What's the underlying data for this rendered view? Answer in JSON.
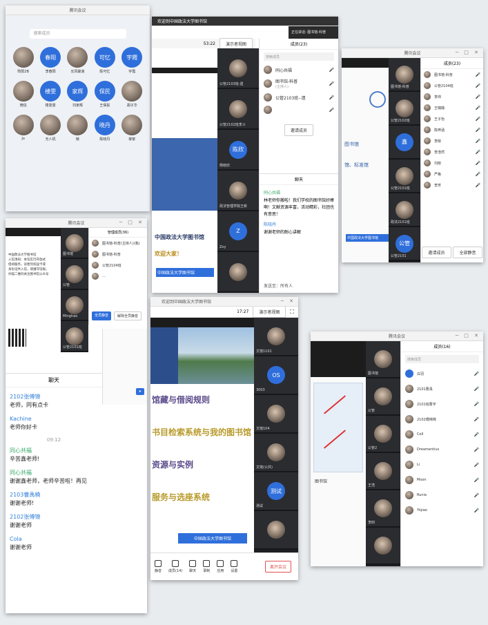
{
  "s1": {
    "title": "腾讯会议",
    "search_placeholder": "搜索成员",
    "grid": [
      {
        "text": "",
        "label": "昀阳2B",
        "photo": true
      },
      {
        "text": "春阳",
        "label": "李春阳",
        "photo": false
      },
      {
        "text": "",
        "label": "长风破浪",
        "photo": true
      },
      {
        "text": "可忆",
        "label": "陈可忆",
        "photo": false
      },
      {
        "text": "宇霞",
        "label": "宇霞",
        "photo": false
      },
      {
        "text": "",
        "label": "微信",
        "photo": true
      },
      {
        "text": "楼雯",
        "label": "楼雯雯",
        "photo": false
      },
      {
        "text": "家辉",
        "label": "刘家辉",
        "photo": false
      },
      {
        "text": "保民",
        "label": "王保民",
        "photo": false
      },
      {
        "text": "",
        "label": "胡子华",
        "photo": true
      },
      {
        "text": "",
        "label": "Jo",
        "photo": true
      },
      {
        "text": "",
        "label": "无人机",
        "photo": true
      },
      {
        "text": "",
        "label": "敏",
        "photo": true
      },
      {
        "text": "晓丹",
        "label": "陈晓丹",
        "photo": false
      },
      {
        "text": "",
        "label": "柳絮",
        "photo": true
      }
    ]
  },
  "s2": {
    "title": "欢迎到中国政法大学图书馆",
    "time": "53:22",
    "view_label": "演示者视图",
    "panel_title": "正在讲话: 图书馆-科普",
    "members_title": "成员(23)",
    "search_placeholder": "搜索成员",
    "members": [
      {
        "name": "同心共福",
        "sub": ""
      },
      {
        "name": "图书馆-科普",
        "sub": "(主持人)"
      },
      {
        "name": "公管2103班--遗",
        "sub": ""
      },
      {
        "name": "",
        "sub": ""
      }
    ],
    "invite_btn": "邀请成员",
    "chat_title": "聊天",
    "chat": [
      {
        "name": "同心共福",
        "text": "林老师你搬啦！我们学校的图书馆好棒啊！文献资源丰富，活动精彩，社团也有意思！",
        "color": "green"
      },
      {
        "name": "陈晓丹",
        "text": "谢谢老师的耐心讲解",
        "color": "blue"
      }
    ],
    "send_to": "发送至：所有人",
    "slide_lines": [
      "中国政法大学图书馆",
      "欢迎大家！"
    ],
    "slide_banner": "中国政法大学图书馆",
    "tiles": [
      {
        "name": "公管2103班-遗",
        "type": "photo",
        "text": ""
      },
      {
        "name": "公管2102班李斗",
        "type": "photo",
        "text": ""
      },
      {
        "name": "杨晓欣",
        "type": "blue",
        "text": "陈欣"
      },
      {
        "name": "政法管理学院王新",
        "type": "photo",
        "text": ""
      },
      {
        "name": "Zoy",
        "type": "blue",
        "text": "Z"
      },
      {
        "name": "",
        "type": "photo",
        "text": ""
      }
    ]
  },
  "s3": {
    "title": "腾讯会议",
    "members_title": "成员(23)",
    "members": [
      "图书馆-科普",
      "公管2104班",
      "李帅",
      "王璐璐",
      "王子怡",
      "陈梓涵",
      "李晓",
      "李浩然",
      "刘晓",
      "严格",
      "李芳"
    ],
    "invite_btn": "邀请成员",
    "more_btn": "全部静音",
    "slide_text": [
      "图书馆",
      "馆、标准馆"
    ],
    "banner": "中国政法大学图书馆",
    "tiles": [
      {
        "name": "图书馆-科普",
        "type": "photo",
        "text": ""
      },
      {
        "name": "公管2102班",
        "type": "photo",
        "text": ""
      },
      {
        "name": "",
        "type": "blue",
        "text": "鑫"
      },
      {
        "name": "公管2101班",
        "type": "photo",
        "text": ""
      },
      {
        "name": "政法2101班",
        "type": "photo",
        "text": ""
      },
      {
        "name": "公管2101",
        "type": "blue",
        "text": "公管"
      }
    ]
  },
  "s4": {
    "title": "腾讯会议",
    "panel_title": "管理成员(36)",
    "members": [
      {
        "name": "图书馆-科普(主持人)(我)",
        "sub": ""
      },
      {
        "name": "图书馆-科普",
        "sub": ""
      },
      {
        "name": "公管2104班",
        "sub": ""
      },
      {
        "name": "...",
        "sub": ""
      }
    ],
    "invite_btn": "全员静音",
    "more_btn": "解除全员静音",
    "chat_title": "聊天",
    "chat": [
      {
        "name": "2102张傅锦",
        "text": "老师，同有点卡",
        "color": "blue"
      },
      {
        "name": "Kachine",
        "text": "老师你好卡",
        "color": "blue"
      },
      {
        "name": "",
        "text": "09:12",
        "color": "time"
      },
      {
        "name": "同心共福",
        "text": "辛苦鑫老师!",
        "color": "green"
      },
      {
        "name": "同心共福",
        "text": "谢谢鑫老师，老师辛苦啦！再见",
        "color": "green"
      },
      {
        "name": "2103曹禹楠",
        "text": "谢谢老师!",
        "color": "blue"
      },
      {
        "name": "2102张傅锦",
        "text": "谢谢老师",
        "color": "blue"
      },
      {
        "name": "Cola",
        "text": "谢谢老师",
        "color": "blue"
      }
    ],
    "left_text": [
      "中国政法大学图书馆",
      "入馆须知：本馆实行开放式",
      "借阅服务，读者凭校园卡或",
      "身份证件入馆，请遵守馆规。",
      "扫描二维码关注图书馆公众号"
    ],
    "tiles": [
      {
        "name": "图书馆",
        "type": "photo"
      },
      {
        "name": "公管",
        "type": "photo"
      },
      {
        "name": "Minghao",
        "type": "photo"
      },
      {
        "name": "公管2101班",
        "type": "photo"
      }
    ]
  },
  "s5": {
    "title": "欢迎到中国政法大学图书馆",
    "time": "17:27",
    "view_label": "演示者视图",
    "slide_lines": [
      "馆藏与借阅规则",
      "书目检索系统与我的图书馆",
      "资源与实例",
      "服务与选座系统"
    ],
    "banner": "中国政法大学图书馆",
    "tiles": [
      {
        "name": "文馆1101",
        "type": "photo",
        "text": ""
      },
      {
        "name": "3003",
        "type": "blue",
        "text": "OS"
      },
      {
        "name": "文馆104",
        "type": "photo",
        "text": ""
      },
      {
        "name": "文馆(公共)",
        "type": "photo",
        "text": ""
      },
      {
        "name": "测试",
        "type": "blue",
        "text": "测试"
      },
      {
        "name": "",
        "type": "photo",
        "text": ""
      }
    ],
    "toolbar": [
      "静音",
      "成员(14)",
      "聊天",
      "录制",
      "应用",
      "设置"
    ],
    "leave_btn": "离开会议"
  },
  "s6": {
    "title": "腾讯会议",
    "panel_title": "成员(16)",
    "search_placeholder": "搜索成员",
    "members": [
      "白羽",
      "2101曹禹",
      "2101班曹宇",
      "2102傅锦锦",
      "Cell",
      "Dreamentius",
      "Li",
      "Moon",
      "Runia",
      "Yiqiao"
    ],
    "tiles": [
      {
        "name": "图书馆",
        "type": "photo"
      },
      {
        "name": "公管",
        "type": "photo"
      },
      {
        "name": "公管2",
        "type": "photo"
      },
      {
        "name": "王浩",
        "type": "photo"
      },
      {
        "name": "李四",
        "type": "photo"
      },
      {
        "name": "",
        "type": "photo"
      }
    ],
    "left_label": "图书馆"
  }
}
